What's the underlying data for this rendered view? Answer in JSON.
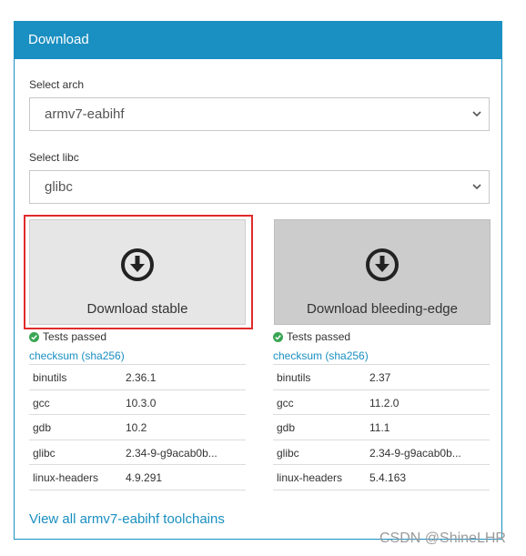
{
  "panel": {
    "title": "Download"
  },
  "arch": {
    "label": "Select arch",
    "selected": "armv7-eabihf"
  },
  "libc": {
    "label": "Select libc",
    "selected": "glibc"
  },
  "stable": {
    "button_label": "Download stable",
    "tests": "Tests passed",
    "checksum": "checksum (sha256)",
    "packages": [
      {
        "name": "binutils",
        "version": "2.36.1"
      },
      {
        "name": "gcc",
        "version": "10.3.0"
      },
      {
        "name": "gdb",
        "version": "10.2"
      },
      {
        "name": "glibc",
        "version": "2.34-9-g9acab0b..."
      },
      {
        "name": "linux-headers",
        "version": "4.9.291"
      }
    ]
  },
  "edge": {
    "button_label": "Download bleeding-edge",
    "tests": "Tests passed",
    "checksum": "checksum (sha256)",
    "packages": [
      {
        "name": "binutils",
        "version": "2.37"
      },
      {
        "name": "gcc",
        "version": "11.2.0"
      },
      {
        "name": "gdb",
        "version": "11.1"
      },
      {
        "name": "glibc",
        "version": "2.34-9-g9acab0b..."
      },
      {
        "name": "linux-headers",
        "version": "5.4.163"
      }
    ]
  },
  "view_all": "View all armv7-eabihf toolchains",
  "watermark": "CSDN @ShineLHR",
  "colors": {
    "accent": "#1a8fc1",
    "highlight": "#e02b2b",
    "success": "#3aa655"
  }
}
